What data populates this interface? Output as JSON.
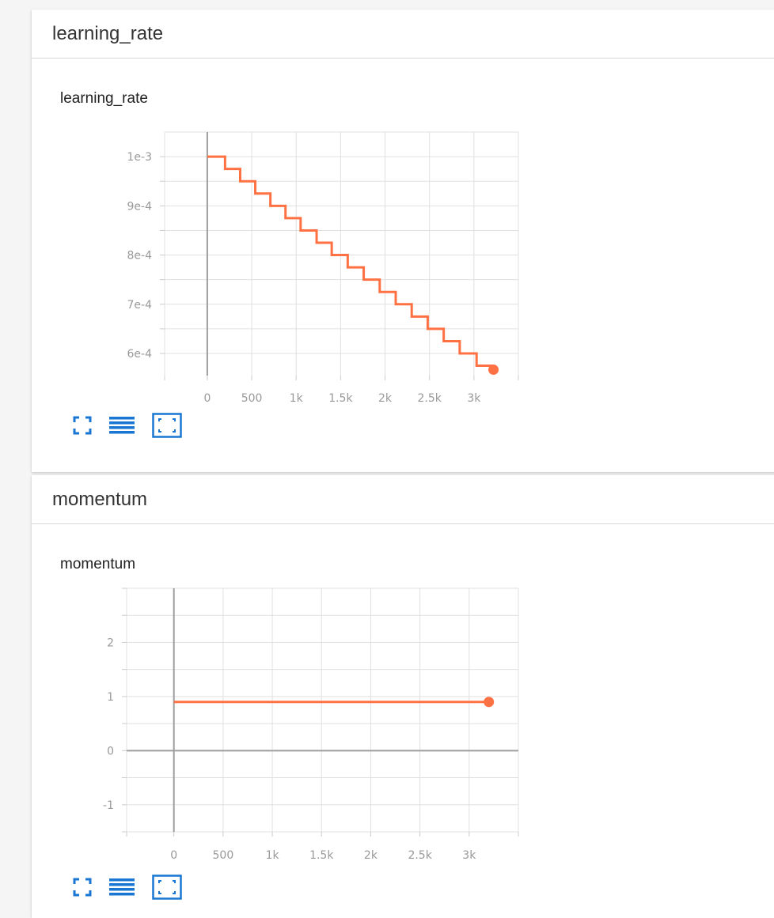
{
  "colors": {
    "series": "#ff7043",
    "grid": "#e0e0e0",
    "axis": "#9e9e9e",
    "icon": "#1976d2"
  },
  "toolbar_icons": [
    "fullscreen-icon",
    "toggle-log-scale-icon",
    "fit-domain-icon"
  ],
  "cards": [
    {
      "header": "learning_rate",
      "chart_title": "learning_rate",
      "chart_data": {
        "type": "line",
        "title": "learning_rate",
        "x_ticks": [
          "0",
          "500",
          "1k",
          "1.5k",
          "2k",
          "2.5k",
          "3k"
        ],
        "y_ticks": [
          "1e-3",
          "9e-4",
          "8e-4",
          "7e-4",
          "6e-4"
        ],
        "xlim": [
          -480,
          3500
        ],
        "ylim": [
          0.000555,
          0.00105
        ],
        "series": [
          {
            "step": true,
            "x": [
              0,
              200,
              370,
              540,
              710,
              880,
              1050,
              1230,
              1400,
              1580,
              1760,
              1940,
              2120,
              2300,
              2480,
              2660,
              2840,
              3030,
              3220
            ],
            "y": [
              0.001,
              0.000975,
              0.00095,
              0.000925,
              0.0009,
              0.000875,
              0.00085,
              0.000825,
              0.0008,
              0.000775,
              0.00075,
              0.000725,
              0.0007,
              0.000675,
              0.00065,
              0.000625,
              0.0006,
              0.000575,
              0.000575
            ]
          }
        ]
      }
    },
    {
      "header": "momentum",
      "chart_title": "momentum",
      "chart_data": {
        "type": "line",
        "title": "momentum",
        "x_ticks": [
          "0",
          "500",
          "1k",
          "1.5k",
          "2k",
          "2.5k",
          "3k"
        ],
        "y_ticks": [
          "2",
          "1",
          "0",
          "-1"
        ],
        "xlim": [
          -480,
          3500
        ],
        "ylim": [
          -1.5,
          3
        ],
        "series": [
          {
            "step": false,
            "x": [
              0,
              3200
            ],
            "y": [
              0.9,
              0.9
            ]
          }
        ]
      }
    }
  ]
}
